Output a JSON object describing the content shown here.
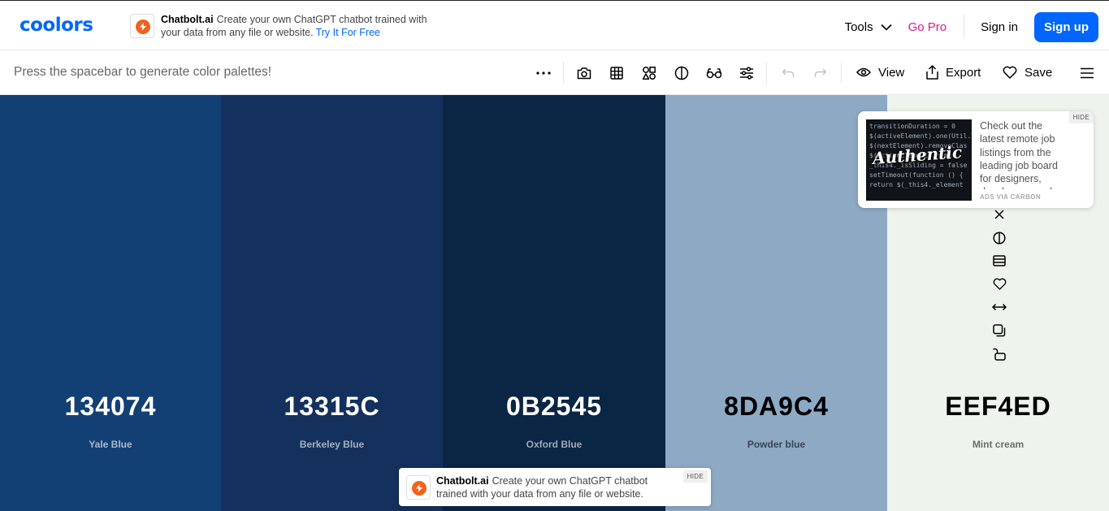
{
  "topnav": {
    "logo": "coolors",
    "ad": {
      "brand": "Chatbolt.ai",
      "text": "Create your own ChatGPT chatbot trained with your data from any file or website.",
      "cta": "Try It For Free"
    },
    "tools_label": "Tools",
    "gopro_label": "Go Pro",
    "signin_label": "Sign in",
    "signup_label": "Sign up",
    "colors": {
      "brand": "#0066ff",
      "gopro": "#e5188e"
    }
  },
  "toolbar": {
    "hint": "Press the spacebar to generate color palettes!",
    "icons": [
      "more-icon",
      "camera-icon",
      "grid-icon",
      "shapes-icon",
      "contrast-icon",
      "glasses-icon",
      "sliders-icon",
      "undo-icon",
      "redo-icon"
    ],
    "view_label": "View",
    "export_label": "Export",
    "save_label": "Save"
  },
  "palette": {
    "colors": [
      {
        "hex": "134074",
        "name": "Yale Blue",
        "bg": "#134074",
        "fg": "#ffffff",
        "name_color": "#a9b9cc"
      },
      {
        "hex": "13315C",
        "name": "Berkeley Blue",
        "bg": "#13315c",
        "fg": "#ffffff",
        "name_color": "#a6b1c0"
      },
      {
        "hex": "0B2545",
        "name": "Oxford Blue",
        "bg": "#0b2545",
        "fg": "#ffffff",
        "name_color": "#a0a9b6"
      },
      {
        "hex": "8DA9C4",
        "name": "Powder blue",
        "bg": "#8da9c4",
        "fg": "#000000",
        "name_color": "#3a4651"
      },
      {
        "hex": "EEF4ED",
        "name": "Mint cream",
        "bg": "#eef4ed",
        "fg": "#000000",
        "name_color": "#6b6e6b"
      }
    ],
    "side_tools": [
      "close-icon",
      "contrast-icon",
      "shades-icon",
      "heart-icon",
      "drag-icon",
      "copy-icon",
      "lock-icon"
    ]
  },
  "carbon_ad": {
    "text": "Check out the latest remote job listings from the leading job board for designers, developers, and creative pros.",
    "image_word": "Authentic",
    "via": "ADS VIA CARBON",
    "hide": "HIDE"
  },
  "bottom_ad": {
    "brand": "Chatbolt.ai",
    "text": "Create your own ChatGPT chatbot trained with your data from any file or website.",
    "hide": "HIDE"
  }
}
